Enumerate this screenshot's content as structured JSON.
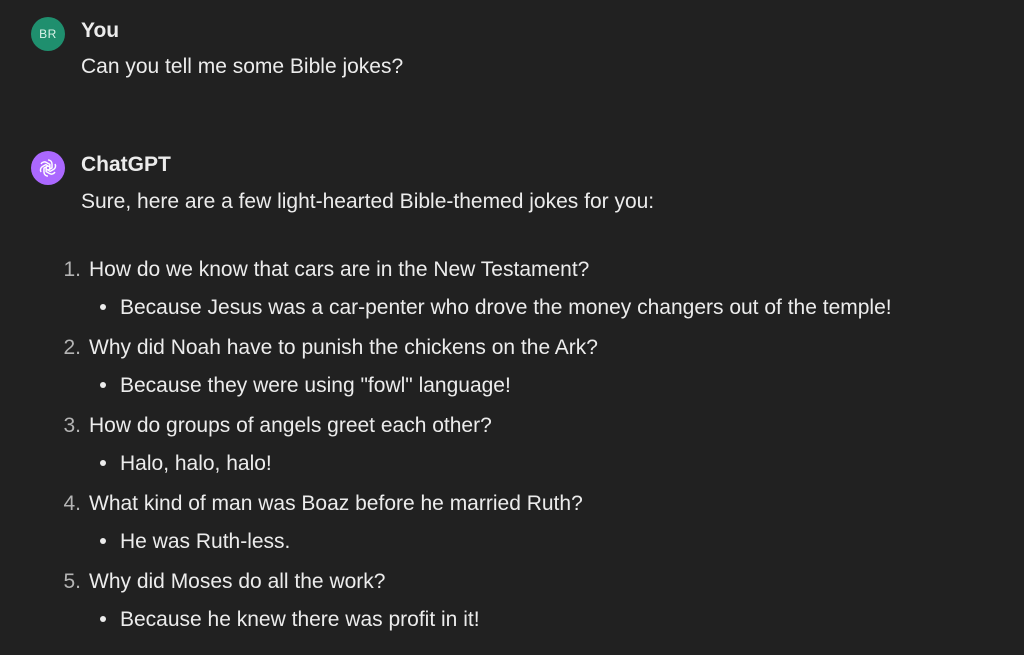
{
  "user_message": {
    "avatar_initials": "BR",
    "author": "You",
    "text": "Can you tell me some Bible jokes?"
  },
  "assistant_message": {
    "avatar_icon": "openai-logo-icon",
    "author": "ChatGPT",
    "intro": "Sure, here are a few light-hearted Bible-themed jokes for you:",
    "jokes": [
      {
        "number": "1.",
        "question": "How do we know that cars are in the New Testament?",
        "answer": "Because Jesus was a car-penter who drove the money changers out of the temple!"
      },
      {
        "number": "2.",
        "question": "Why did Noah have to punish the chickens on the Ark?",
        "answer": "Because they were using \"fowl\" language!"
      },
      {
        "number": "3.",
        "question": "How do groups of angels greet each other?",
        "answer": "Halo, halo, halo!"
      },
      {
        "number": "4.",
        "question": "What kind of man was Boaz before he married Ruth?",
        "answer": "He was Ruth-less."
      },
      {
        "number": "5.",
        "question": "Why did Moses do all the work?",
        "answer": "Because he knew there was profit in it!"
      }
    ]
  },
  "colors": {
    "background": "#212121",
    "text": "#ececec",
    "muted": "#b4b4b4",
    "user_avatar": "#1f8f6e",
    "assistant_avatar": "#ab68ff"
  }
}
